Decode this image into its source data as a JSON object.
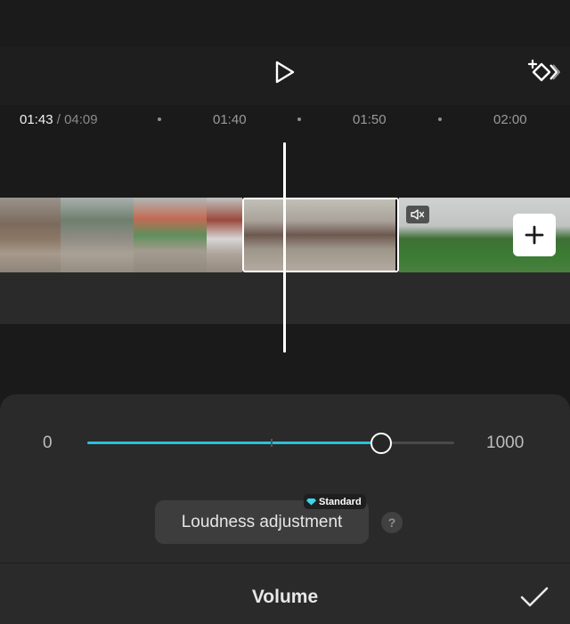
{
  "toolbar": {
    "play_icon": "play-icon",
    "keyframe_icon": "add-keyframe-icon"
  },
  "timeline": {
    "current_time": "01:43",
    "separator": "/",
    "total_time": "04:09",
    "ticks": [
      "01:40",
      "01:50",
      "02:00"
    ]
  },
  "clips": {
    "selected_clip": "video-clip",
    "next_clip_muted_icon": "muted-speaker-icon",
    "add_icon": "plus-icon"
  },
  "volume_panel": {
    "min_label": "0",
    "max_label": "1000",
    "value_fraction": 0.8,
    "accent_color": "#27c2d9",
    "loudness_button": "Loudness adjustment",
    "badge_label": "Standard",
    "help_label": "?",
    "title": "Volume",
    "confirm_icon": "checkmark-icon"
  }
}
